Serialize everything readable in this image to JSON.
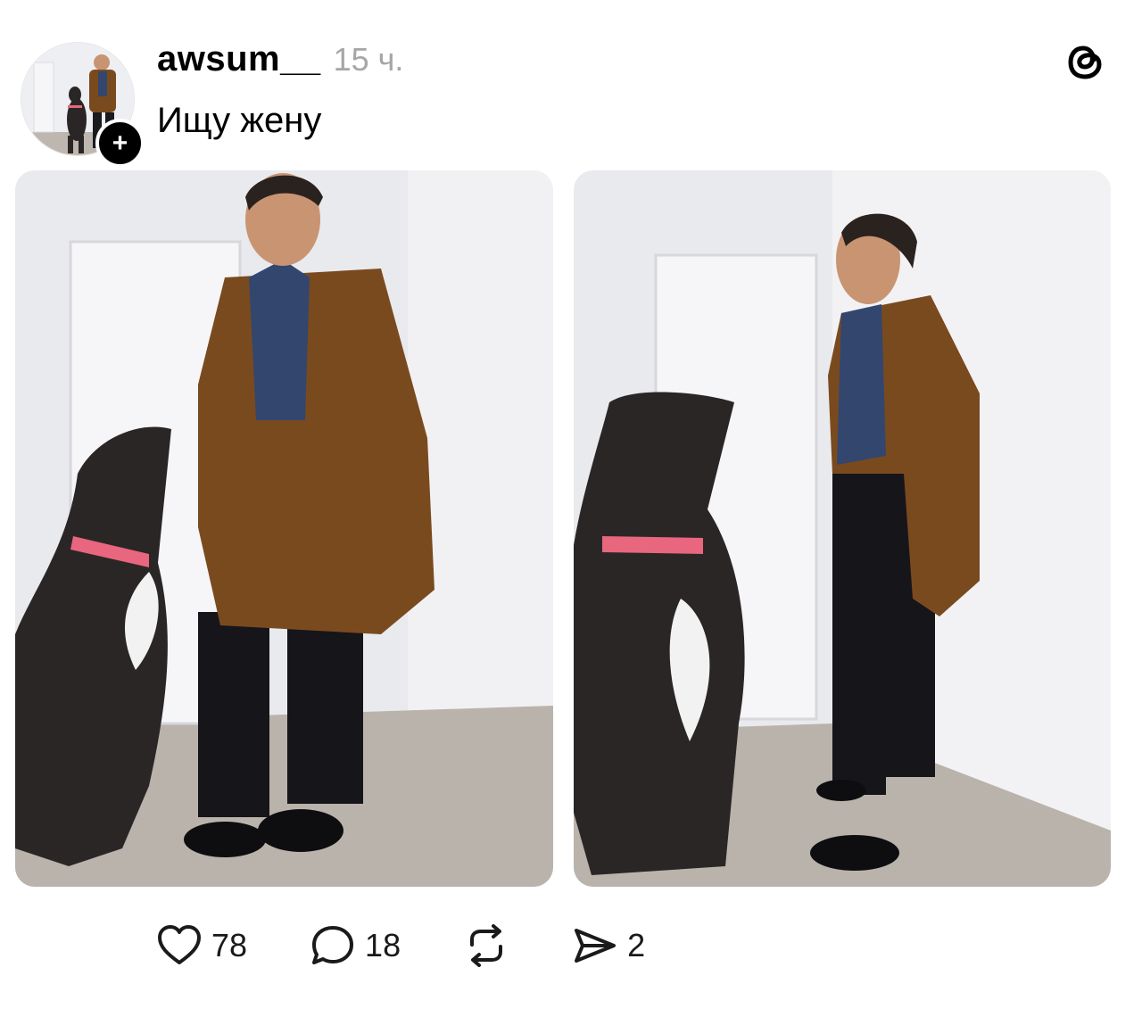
{
  "post": {
    "username": "awsum__",
    "timestamp": "15 ч.",
    "caption": "Ищу жену",
    "follow_symbol": "+"
  },
  "icons": {
    "app_logo": "threads-logo-icon",
    "like": "heart-icon",
    "reply": "speech-bubble-icon",
    "repost": "repost-arrows-icon",
    "share": "paper-plane-icon"
  },
  "actions": {
    "likes": "78",
    "replies": "18",
    "shares": "2"
  },
  "colors": {
    "coat": "#7a4a1f",
    "dog": "#2b2626",
    "collar": "#e8667e",
    "wall": "#e9eaee",
    "floor": "#b9b3ab"
  }
}
